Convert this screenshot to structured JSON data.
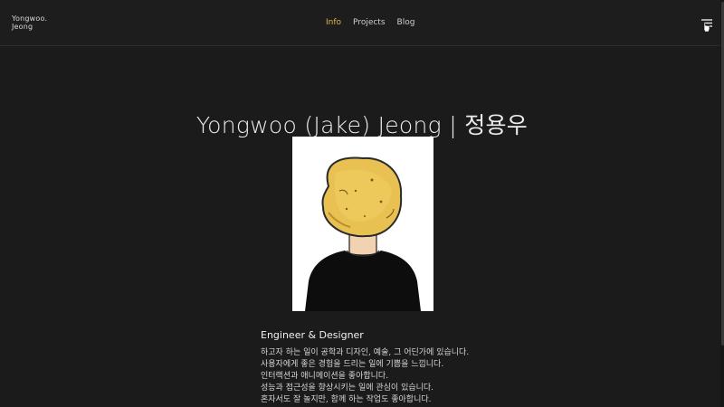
{
  "header": {
    "brand_line1": "Yongwoo.",
    "brand_line2": "Jeong",
    "nav": [
      {
        "label": "Info",
        "active": true
      },
      {
        "label": "Projects",
        "active": false
      },
      {
        "label": "Blog",
        "active": false
      }
    ],
    "menu_icon": "filter-list-icon"
  },
  "main": {
    "title": "Yongwoo (Jake) Jeong | 정용우",
    "avatar_icon": "potato-head-avatar",
    "subtitle": "Engineer & Designer",
    "bio": [
      "하고자 하는 일이 공학과 디자인, 예술, 그 어딘가에 있습니다.",
      "사용자에게 좋은 경험을 드리는 일에 기쁨을 느낍니다.",
      "인터랙션과 애니메이션을 좋아합니다.",
      "성능과 접근성을 향상시키는 일에 관심이 있습니다.",
      "혼자서도 잘 놀지만, 함께 하는 작업도 좋아합니다."
    ]
  },
  "colors": {
    "background": "#1b1b1b",
    "accent": "#e0b84a",
    "text": "#e8e8e8"
  }
}
